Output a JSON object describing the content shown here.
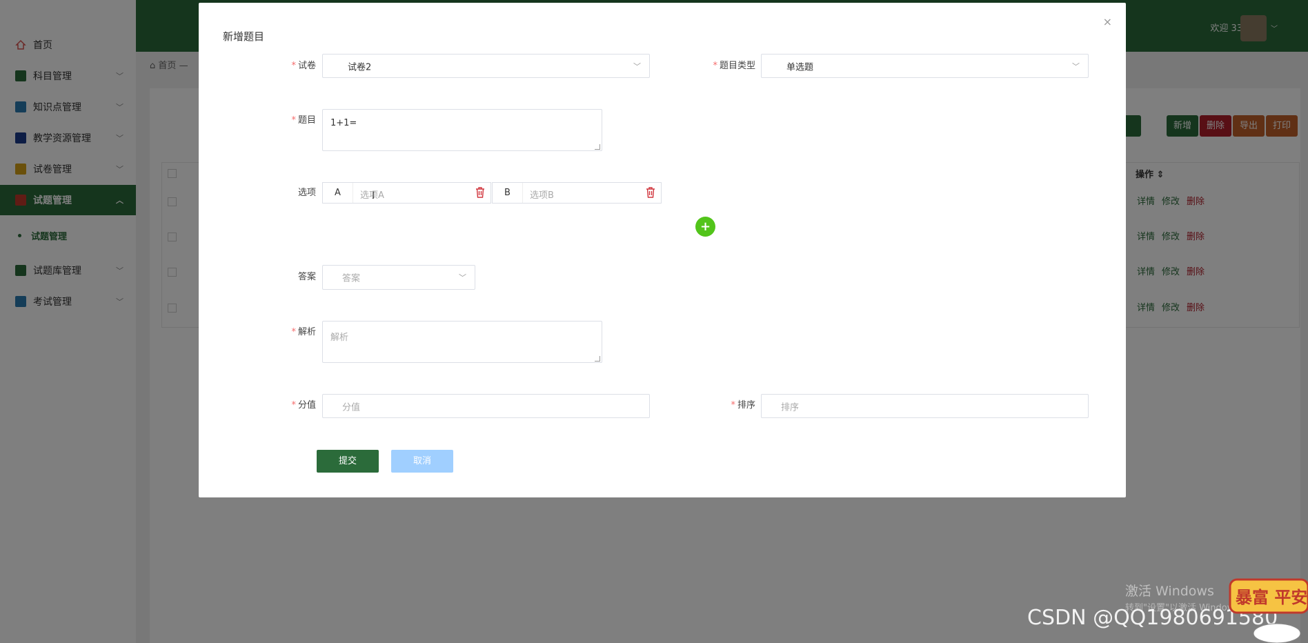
{
  "sidebar": {
    "items": [
      {
        "label": "首页",
        "icon": "home-icon",
        "color": "#d9534f"
      },
      {
        "label": "科目管理",
        "icon": "book-icon",
        "color": "#2b6b3a"
      },
      {
        "label": "知识点管理",
        "icon": "folder-icon",
        "color": "#2a7ab0"
      },
      {
        "label": "教学资源管理",
        "icon": "document-icon",
        "color": "#1a3a8a"
      },
      {
        "label": "试卷管理",
        "icon": "paper-icon",
        "color": "#d4a017"
      },
      {
        "label": "试题管理",
        "icon": "question-icon",
        "color": "#c0392b"
      },
      {
        "label": "试题库管理",
        "icon": "library-icon",
        "color": "#2b6b3a"
      },
      {
        "label": "考试管理",
        "icon": "exam-icon",
        "color": "#2a7ab0"
      }
    ],
    "submenu": {
      "label": "试题管理"
    }
  },
  "header": {
    "welcome": "欢迎 33",
    "accent": "#2b6b3a"
  },
  "breadcrumb": {
    "home": "首页",
    "sep": "—"
  },
  "toolbar": {
    "add": "新增",
    "delete": "删除",
    "export": "导出",
    "print": "打印"
  },
  "table": {
    "op_header": "操作",
    "rows": [
      {
        "detail": "详情",
        "edit": "修改",
        "del": "删除"
      },
      {
        "detail": "详情",
        "edit": "修改",
        "del": "删除"
      },
      {
        "detail": "详情",
        "edit": "修改",
        "del": "删除"
      },
      {
        "detail": "详情",
        "edit": "修改",
        "del": "删除"
      }
    ]
  },
  "modal": {
    "title": "新增题目",
    "close": "×",
    "fields": {
      "paper": {
        "label": "试卷",
        "value": "试卷2"
      },
      "type": {
        "label": "题目类型",
        "value": "单选题"
      },
      "question": {
        "label": "题目",
        "value": "1+1="
      },
      "options": {
        "label": "选项",
        "items": [
          {
            "letter": "A",
            "placeholder": "选项A"
          },
          {
            "letter": "B",
            "placeholder": "选项B"
          }
        ]
      },
      "answer": {
        "label": "答案",
        "placeholder": "答案"
      },
      "analysis": {
        "label": "解析",
        "placeholder": "解析"
      },
      "score": {
        "label": "分值",
        "placeholder": "分值"
      },
      "order": {
        "label": "排序",
        "placeholder": "排序"
      }
    },
    "add_option": "+",
    "submit": "提交",
    "cancel": "取消"
  },
  "watermarks": {
    "windows": "激活 Windows",
    "windows_sub": "转到\"设置\"以激活 Windows。",
    "csdn": "CSDN @QQ1980691580",
    "sticker": "暴富 平安"
  }
}
